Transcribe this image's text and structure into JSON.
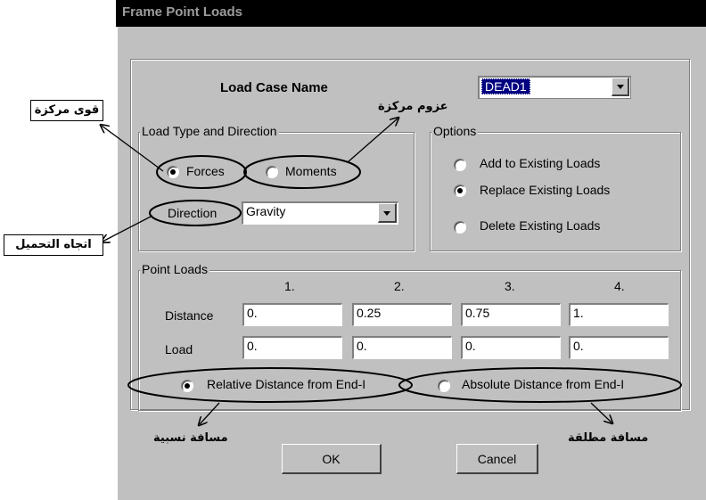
{
  "window": {
    "title": "Frame Point Loads"
  },
  "load_case": {
    "label": "Load Case Name",
    "value": "DEAD1"
  },
  "load_type": {
    "legend": "Load Type and Direction",
    "forces_label": "Forces",
    "moments_label": "Moments",
    "selected": "Forces",
    "direction_label": "Direction",
    "direction_value": "Gravity"
  },
  "options": {
    "legend": "Options",
    "items": [
      "Add to Existing Loads",
      "Replace Existing Loads",
      "Delete Existing Loads"
    ],
    "selected": "Replace Existing Loads"
  },
  "point_loads": {
    "legend": "Point Loads",
    "columns": [
      "1.",
      "2.",
      "3.",
      "4."
    ],
    "distance_label": "Distance",
    "distances": [
      "0.",
      "0.25",
      "0.75",
      "1."
    ],
    "load_label": "Load",
    "loads": [
      "0.",
      "0.",
      "0.",
      "0."
    ],
    "relative_label": "Relative Distance from End-I",
    "absolute_label": "Absolute Distance from End-I",
    "selected": "Relative Distance from End-I"
  },
  "buttons": {
    "ok": "OK",
    "cancel": "Cancel"
  },
  "annotations": {
    "forces": "قوى مركزة",
    "moments": "عزوم مركزة",
    "direction": "اتجاه التحميل",
    "relative": "مسافة نسبية",
    "absolute": "مسافة مطلقة"
  }
}
